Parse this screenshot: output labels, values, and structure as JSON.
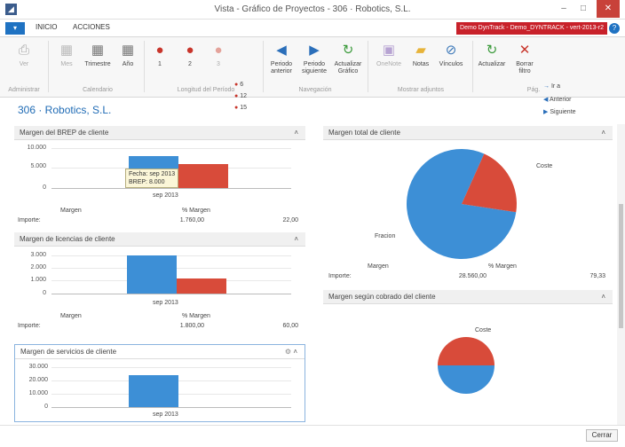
{
  "window": {
    "title": "Vista - Gráfico de Proyectos - 306 · Robotics, S.L.",
    "close": "✕",
    "max": "□",
    "min": "–",
    "app_icon": "◢"
  },
  "tabs": {
    "menu": "▾",
    "inicio": "INICIO",
    "acciones": "ACCIONES",
    "demo_banner": "Demo DynTrack - Demo_DYNTRACK - vert-2013-r2",
    "help": "?"
  },
  "ribbon": {
    "ver": "Ver",
    "mes": "Mes",
    "trimestre": "Trimestre",
    "ano": "Año",
    "len1": "1",
    "len2": "2",
    "len3": "3",
    "len6": "6",
    "len12": "12",
    "len15": "15",
    "periodo_anterior_1": "Periodo",
    "periodo_anterior_2": "anterior",
    "periodo_siguiente_1": "Periodo",
    "periodo_siguiente_2": "siguiente",
    "actualizar_grafico_1": "Actualizar",
    "actualizar_grafico_2": "Gráfico",
    "onenote": "OneNote",
    "notas": "Notas",
    "vinculos": "Vínculos",
    "actualizar": "Actualizar",
    "borrar_1": "Borrar",
    "borrar_2": "filtro",
    "ir_a": "Ir a",
    "anterior": "Anterior",
    "siguiente": "Siguiente",
    "groups": {
      "administrar": "Administrar",
      "calendario": "Calendario",
      "longitud": "Longitud del Período",
      "navegacion": "Navegación",
      "adjuntos": "Mostrar adjuntos",
      "pag": "Pág."
    }
  },
  "page_title": "306 · Robotics, S.L.",
  "panels": {
    "brep": {
      "title": "Margen del BREP de cliente",
      "ticks": [
        "10.000",
        "5.000",
        "0"
      ],
      "tooltip_1": "Fecha: sep 2013",
      "tooltip_2": "BREP: 8.000",
      "x_label": "sep 2013",
      "col1": "Margen",
      "col2": "% Margen",
      "row_label": "Importe:",
      "val1": "1.760,00",
      "val2": "22,00"
    },
    "licencias": {
      "title": "Margen de licencias de cliente",
      "ticks": [
        "3.000",
        "2.000",
        "1.000",
        "0"
      ],
      "x_label": "sep 2013",
      "col1": "Margen",
      "col2": "% Margen",
      "row_label": "Importe:",
      "val1": "1.800,00",
      "val2": "60,00"
    },
    "servicios": {
      "title": "Margen de servicios de cliente",
      "ticks": [
        "30.000",
        "20.000",
        "10.000",
        "0"
      ],
      "x_label": "sep 2013"
    },
    "total": {
      "title": "Margen total de cliente",
      "label_coste": "Coste",
      "label_fracion": "Fracion",
      "col1": "Margen",
      "col2": "% Margen",
      "row_label": "Importe:",
      "val1": "28.560,00",
      "val2": "79,33"
    },
    "cobrado": {
      "title": "Margen según cobrado del cliente",
      "label_coste": "Coste"
    },
    "caret": "˄"
  },
  "cerrar": "Cerrar",
  "chart_data": [
    {
      "type": "bar",
      "title": "Margen del BREP de cliente",
      "categories": [
        "sep 2013"
      ],
      "series": [
        {
          "name": "",
          "color": "#3d8fd6",
          "values": [
            8000
          ]
        },
        {
          "name": "",
          "color": "#d84b3a",
          "values": [
            6000
          ]
        }
      ],
      "ylim": [
        0,
        10000
      ]
    },
    {
      "type": "bar",
      "title": "Margen de licencias de cliente",
      "categories": [
        "sep 2013"
      ],
      "series": [
        {
          "name": "",
          "color": "#3d8fd6",
          "values": [
            3000
          ]
        },
        {
          "name": "",
          "color": "#d84b3a",
          "values": [
            1200
          ]
        }
      ],
      "ylim": [
        0,
        3000
      ]
    },
    {
      "type": "bar",
      "title": "Margen de servicios de cliente",
      "categories": [
        "sep 2013"
      ],
      "series": [
        {
          "name": "",
          "color": "#3d8fd6",
          "values": [
            24000
          ]
        }
      ],
      "ylim": [
        0,
        30000
      ]
    },
    {
      "type": "pie",
      "title": "Margen total de cliente",
      "labels": [
        "Fracion",
        "Coste"
      ],
      "values": [
        79.33,
        20.67
      ],
      "colors": [
        "#3d8fd6",
        "#d84b3a"
      ]
    },
    {
      "type": "pie",
      "title": "Margen según cobrado del cliente",
      "labels": [
        "",
        "Coste"
      ],
      "values": [
        50,
        50
      ],
      "colors": [
        "#3d8fd6",
        "#d84b3a"
      ]
    }
  ]
}
